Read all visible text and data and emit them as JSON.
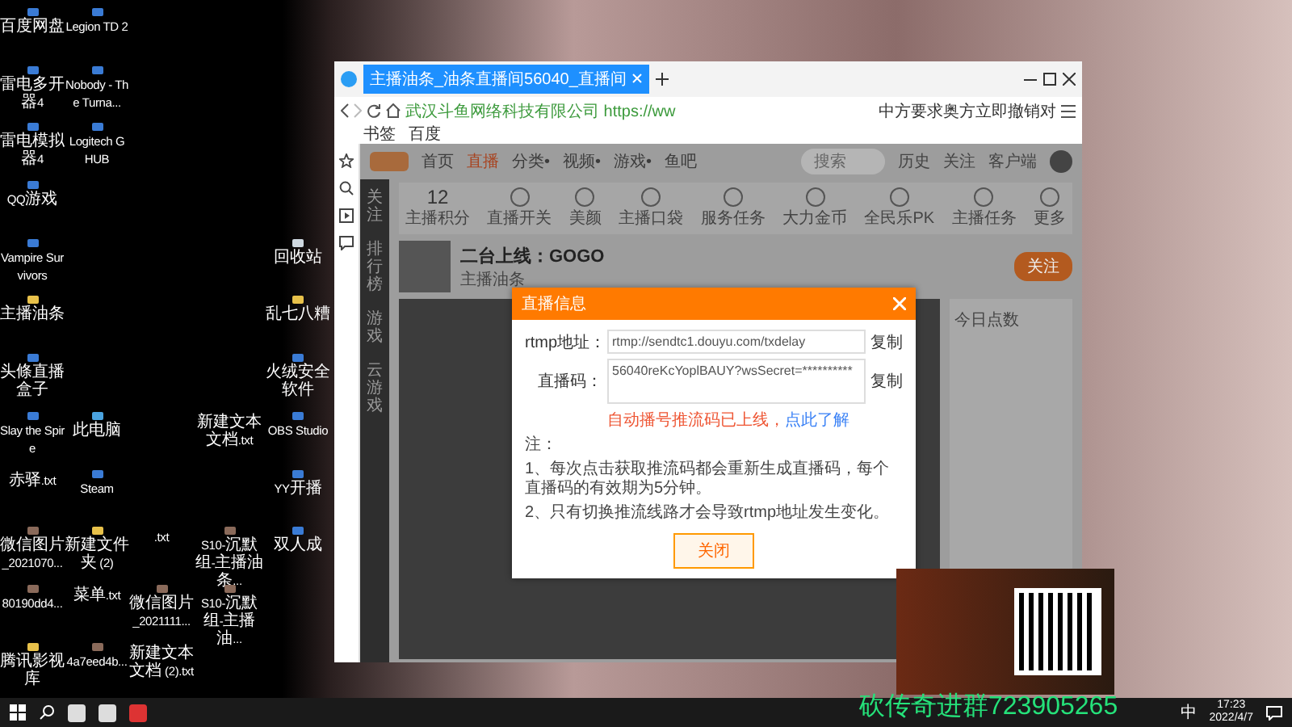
{
  "desktop_columns": [
    [
      {
        "label": "百度网盘",
        "kind": "app"
      },
      {
        "label": "雷电多开器4",
        "kind": "app"
      },
      {
        "label": "雷电模拟器4",
        "kind": "app"
      },
      {
        "label": "QQ游戏",
        "kind": "app"
      },
      {
        "label": "Vampire Survivors",
        "kind": "app"
      },
      {
        "label": "主播油条",
        "kind": "folder"
      },
      {
        "label": "头條直播盒子",
        "kind": "app"
      },
      {
        "label": "Slay the Spire",
        "kind": "app"
      },
      {
        "label": "赤驿.txt",
        "kind": "file"
      },
      {
        "label": "微信图片_2021070...",
        "kind": "image"
      },
      {
        "label": "80190dd4...",
        "kind": "image"
      },
      {
        "label": "腾讯影视库",
        "kind": "folder"
      }
    ],
    [
      {
        "label": "Legion TD 2",
        "kind": "app"
      },
      {
        "label": "Nobody - The Turna...",
        "kind": "app"
      },
      {
        "label": "Logitech G HUB",
        "kind": "app"
      },
      null,
      null,
      null,
      null,
      {
        "label": "此电脑",
        "kind": "computer"
      },
      {
        "label": "Steam",
        "kind": "app"
      },
      {
        "label": "新建文件夹 (2)",
        "kind": "folder"
      },
      {
        "label": "菜单.txt",
        "kind": "file"
      },
      {
        "label": "4a7eed4b...",
        "kind": "image"
      }
    ],
    [
      null,
      null,
      null,
      null,
      null,
      null,
      null,
      null,
      null,
      {
        "label": ".txt",
        "kind": "file"
      },
      {
        "label": "微信图片_2021111...",
        "kind": "image"
      },
      {
        "label": "新建文本文档 (2).txt",
        "kind": "file"
      }
    ],
    [
      null,
      null,
      null,
      null,
      null,
      null,
      null,
      {
        "label": "新建文本文档.txt",
        "kind": "file"
      },
      null,
      {
        "label": "S10-沉默组-主播油条...",
        "kind": "image"
      },
      {
        "label": "S10-沉默组-主播油...",
        "kind": "image"
      },
      null
    ],
    [
      null,
      null,
      null,
      null,
      {
        "label": "回收站",
        "kind": "bin"
      },
      {
        "label": "乱七八糟",
        "kind": "folder"
      },
      {
        "label": "火绒安全软件",
        "kind": "app"
      },
      {
        "label": "OBS Studio",
        "kind": "app"
      },
      {
        "label": "YY开播",
        "kind": "app"
      },
      {
        "label": "双人成",
        "kind": "app"
      },
      null,
      null
    ]
  ],
  "browser": {
    "tab_title": "主播油条_油条直播间56040_直播间",
    "site_name": "武汉斗鱼网络科技有限公司",
    "url": "https://ww",
    "search_text": "中方要求奥方立即撤销对",
    "bookmarks": [
      "书签",
      "百度"
    ]
  },
  "site": {
    "nav": [
      {
        "label": "首页",
        "selected": false
      },
      {
        "label": "直播",
        "selected": true
      },
      {
        "label": "分类•",
        "selected": false
      },
      {
        "label": "视频•",
        "selected": false
      },
      {
        "label": "游戏•",
        "selected": false
      },
      {
        "label": "鱼吧",
        "selected": false
      }
    ],
    "search_placeholder": "搜索",
    "header_links": [
      "历史",
      "关注",
      "客户端"
    ],
    "sidebar": [
      "关注",
      "排行榜",
      "游戏",
      "云游戏"
    ],
    "score": "12",
    "score_label": "主播积分",
    "features": [
      "直播开关",
      "美颜",
      "主播口袋",
      "服务任务",
      "大力金币",
      "全民乐PK",
      "主播任务",
      "更多"
    ],
    "room_title": "二台上线：GOGO",
    "streamer": "主播油条",
    "follow": "关注",
    "right_title": "今日点数"
  },
  "dialog": {
    "title": "直播信息",
    "rtmp_label": "rtmp地址：",
    "rtmp_value": "rtmp://sendtc1.douyu.com/txdelay",
    "code_label": "直播码：",
    "code_value": "56040reKcYoplBAUY?wsSecret=**********",
    "copy": [
      "复制",
      "复制"
    ],
    "warning": "自动播号推流码已上线，",
    "link": "点此了解",
    "notes": [
      "注：",
      "1、每次点击获取推流码都会重新生成直播码，每个直播码的有效期为5分钟。",
      "2、只有切换推流线路才会导致rtmp地址发生变化。"
    ],
    "close_button": "关闭"
  },
  "overlay_text": "砍传奇进群723905265",
  "taskbar": {
    "ime": "中",
    "time": "17:23",
    "date": "2022/4/7"
  }
}
